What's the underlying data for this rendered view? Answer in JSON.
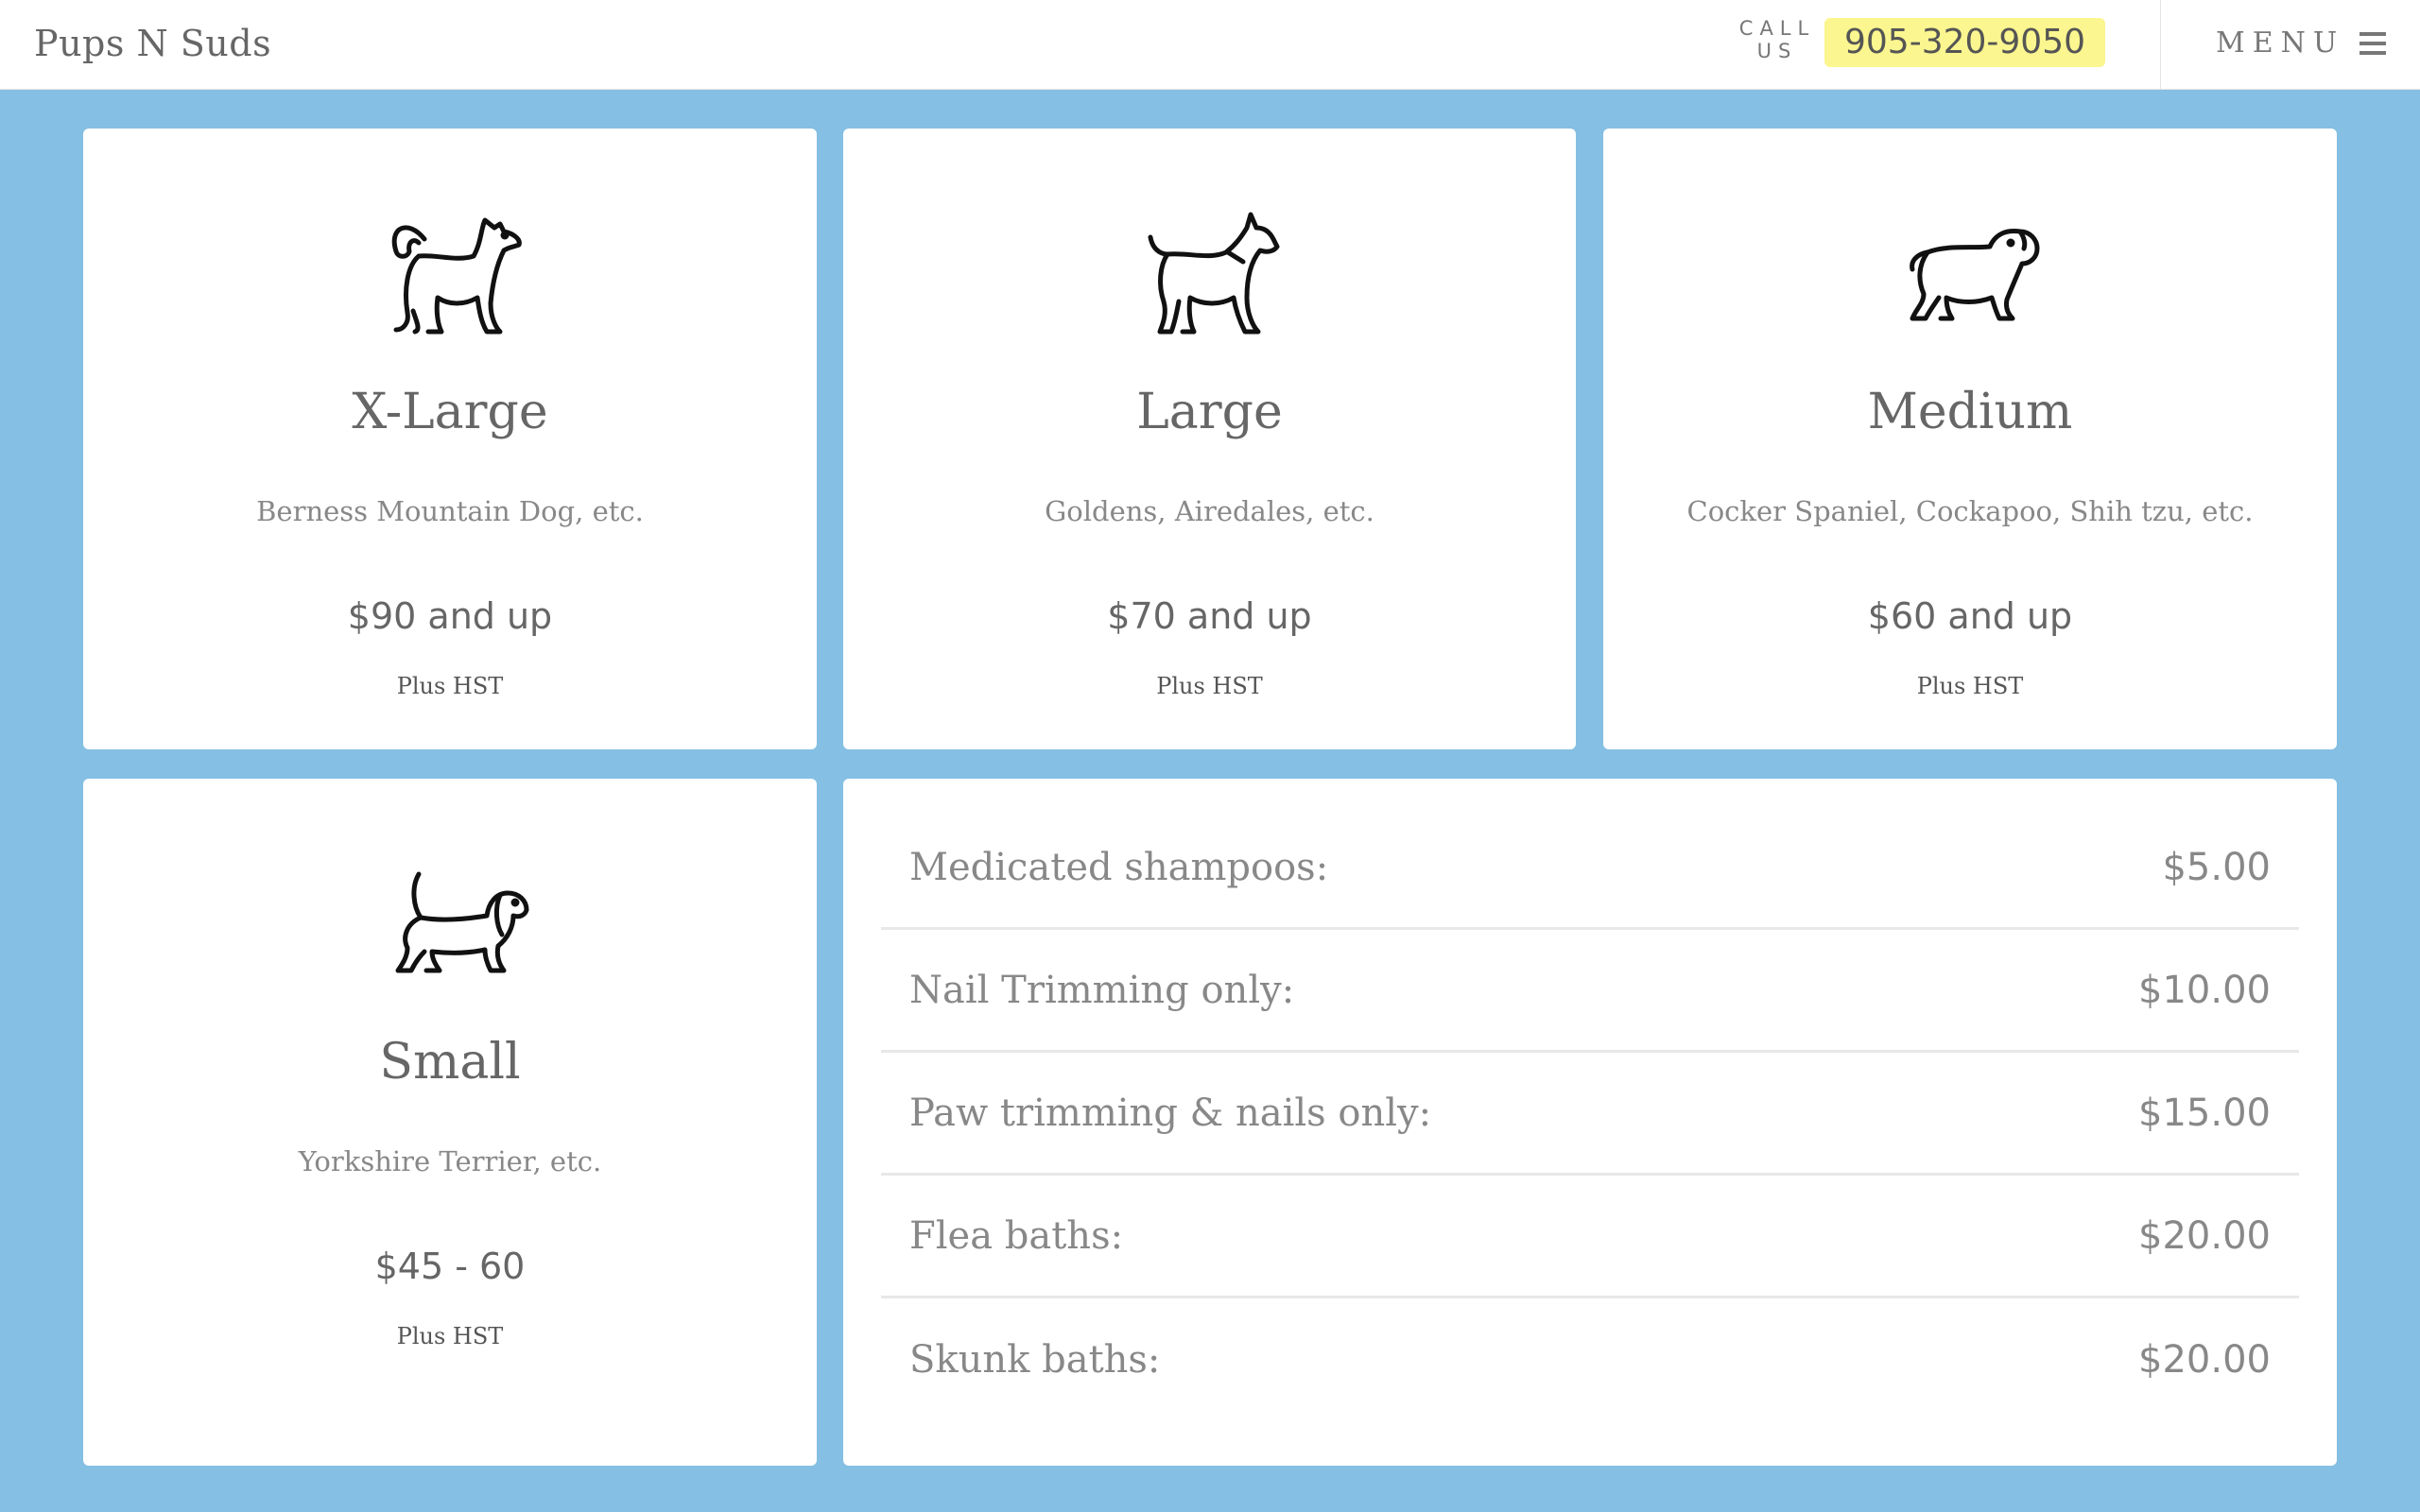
{
  "header": {
    "brand": "Pups N Suds",
    "call_label": "CALL US",
    "phone": "905-320-9050",
    "menu_label": "MENU"
  },
  "sizes": [
    {
      "title": "X-Large",
      "breeds": "Berness Mountain Dog, etc.",
      "price": "$90 and up",
      "tax": "Plus HST",
      "icon": "husky-dog-icon"
    },
    {
      "title": "Large",
      "breeds": "Goldens, Airedales, etc.",
      "price": "$70 and up",
      "tax": "Plus HST",
      "icon": "terrier-dog-icon"
    },
    {
      "title": "Medium",
      "breeds": "Cocker Spaniel, Cockapoo, Shih tzu, etc.",
      "price": "$60 and up",
      "tax": "Plus HST",
      "icon": "bulldog-icon"
    },
    {
      "title": "Small",
      "breeds": "Yorkshire Terrier, etc.",
      "price": "$45 - 60",
      "tax": "Plus HST",
      "icon": "dachshund-icon"
    }
  ],
  "extras": [
    {
      "name": "Medicated shampoos:",
      "price": "$5.00"
    },
    {
      "name": "Nail Trimming only:",
      "price": "$10.00"
    },
    {
      "name": "Paw trimming & nails only:",
      "price": "$15.00"
    },
    {
      "name": "Flea baths:",
      "price": "$20.00"
    },
    {
      "name": "Skunk baths:",
      "price": "$20.00"
    }
  ],
  "colors": {
    "background": "#85bfe3",
    "phone_highlight": "#fbf68f",
    "card": "#ffffff"
  }
}
